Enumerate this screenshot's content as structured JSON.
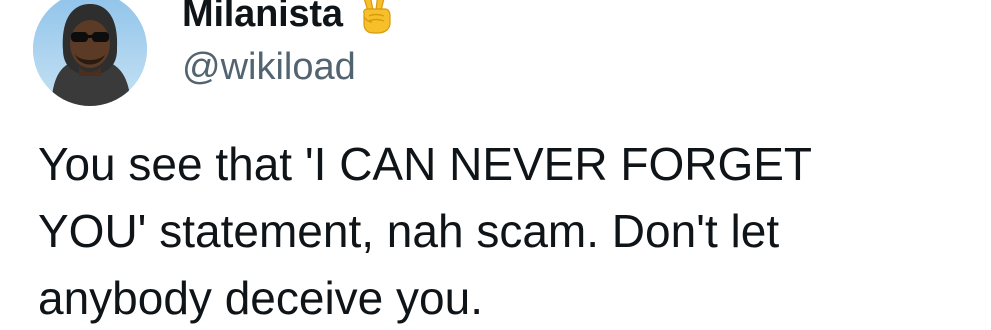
{
  "author": {
    "display_name": "Milanista",
    "name_emoji": "victory-hand-emoji",
    "handle": "@wikiload",
    "avatar": "profile-photo"
  },
  "tweet": {
    "text": "You see that 'I CAN NEVER FORGET\nYOU' statement, nah scam. Don't let\nanybody deceive you."
  },
  "colors": {
    "text": "#0f1419",
    "secondary_text": "#536471",
    "background": "#ffffff",
    "emoji_yellow": "#f7c02a"
  }
}
